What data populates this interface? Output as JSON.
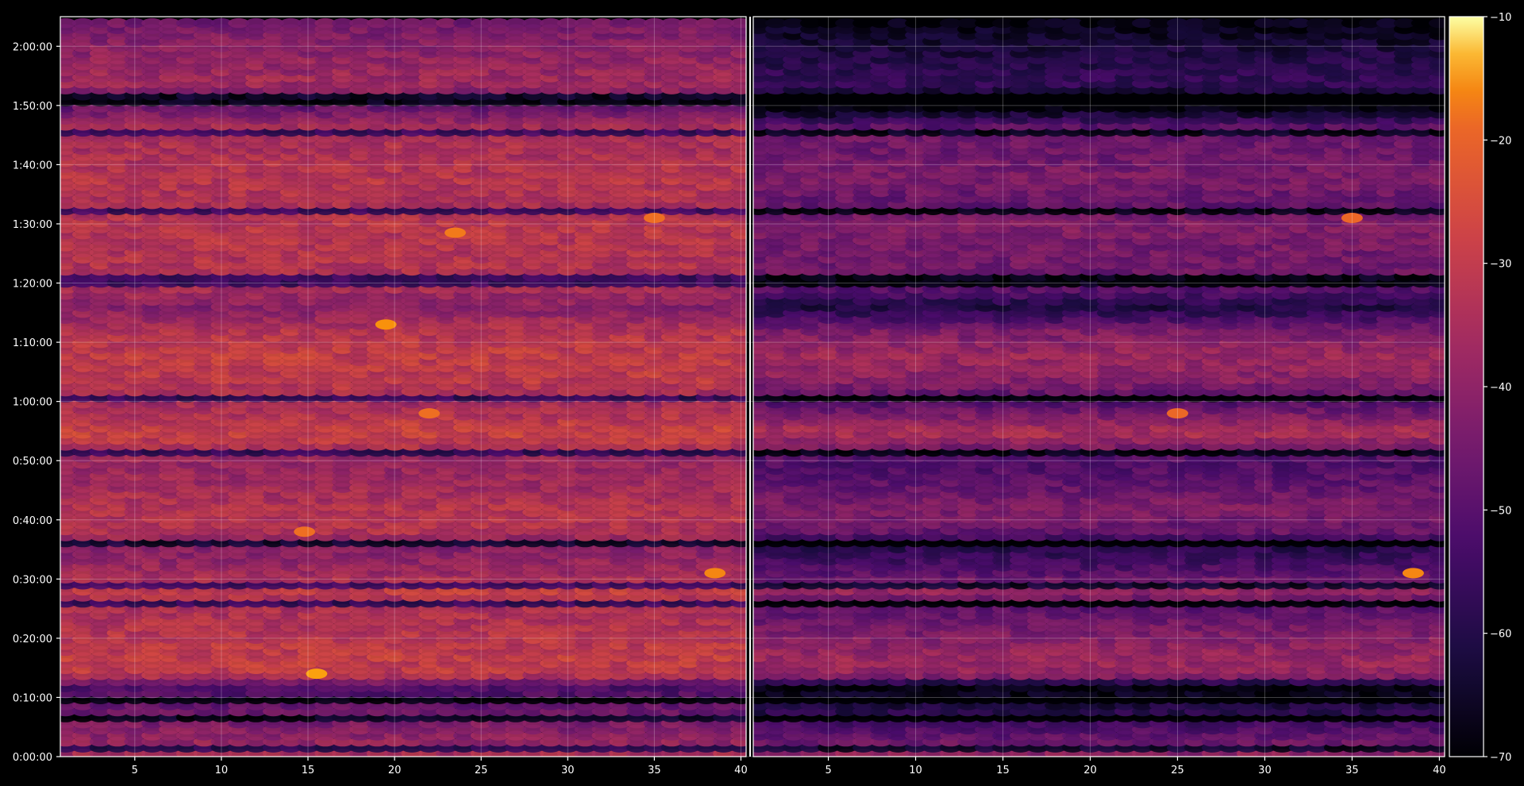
{
  "chart_data": {
    "type": "heatmap",
    "title": "",
    "xlabel": "",
    "ylabel": "",
    "grid": true,
    "colormap": "inferno",
    "colorbar": {
      "vmin": -70,
      "vmax": -10,
      "ticks": [
        "-10",
        "-20",
        "-30",
        "-40",
        "-50",
        "-60",
        "-70"
      ],
      "placement": "right"
    },
    "panels": [
      {
        "name": "left",
        "x_range": [
          1,
          40
        ],
        "x_ticks": [
          "5",
          "10",
          "15",
          "20",
          "25",
          "30",
          "35",
          "40"
        ]
      },
      {
        "name": "right",
        "x_range": [
          1,
          40
        ],
        "x_ticks": [
          "5",
          "10",
          "15",
          "20",
          "25",
          "30",
          "35",
          "40"
        ]
      }
    ],
    "y_range_seconds": [
      0,
      7500
    ],
    "y_ticks": [
      "0:00:00",
      "0:10:00",
      "0:20:00",
      "0:30:00",
      "0:40:00",
      "0:50:00",
      "1:00:00",
      "1:10:00",
      "1:20:00",
      "1:30:00",
      "1:40:00",
      "1:50:00",
      "2:00:00"
    ],
    "row_profile_y_minutes": [
      0,
      5,
      12,
      14,
      17,
      22,
      26,
      28,
      31,
      36,
      38,
      42,
      46,
      50,
      55,
      57,
      60,
      64,
      68,
      72,
      76,
      80,
      86,
      90,
      93,
      98,
      102,
      106,
      110,
      114,
      120,
      124
    ],
    "row_profile_left_db": [
      -34,
      -42,
      -52,
      -30,
      -29,
      -32,
      -34,
      -29,
      -36,
      -42,
      -33,
      -32,
      -36,
      -38,
      -27,
      -31,
      -36,
      -30,
      -29,
      -32,
      -41,
      -33,
      -32,
      -31,
      -34,
      -31,
      -34,
      -33,
      -48,
      -36,
      -40,
      -44
    ],
    "right_panel_offset_db": [
      -4,
      -10,
      -18,
      -8,
      -8,
      -12,
      -16,
      -9,
      -13,
      -18,
      -14,
      -10,
      -12,
      -14,
      -6,
      -9,
      -15,
      -10,
      -8,
      -11,
      -20,
      -13,
      -12,
      -11,
      -14,
      -12,
      -12,
      -12,
      -24,
      -20,
      -22,
      -24
    ],
    "highlight_points": [
      {
        "panel": "left",
        "x": 15.5,
        "y_minutes": 14,
        "value": -14
      },
      {
        "panel": "left",
        "x": 19.5,
        "y_minutes": 73,
        "value": -15
      },
      {
        "panel": "left",
        "x": 14.8,
        "y_minutes": 38,
        "value": -18
      },
      {
        "panel": "left",
        "x": 23.5,
        "y_minutes": 88.5,
        "value": -17
      },
      {
        "panel": "left",
        "x": 35,
        "y_minutes": 91,
        "value": -18
      },
      {
        "panel": "left",
        "x": 38.5,
        "y_minutes": 31,
        "value": -16
      },
      {
        "panel": "left",
        "x": 22,
        "y_minutes": 58,
        "value": -18
      },
      {
        "panel": "right",
        "x": 38.5,
        "y_minutes": 31,
        "value": -16
      },
      {
        "panel": "right",
        "x": 35,
        "y_minutes": 91,
        "value": -19
      },
      {
        "panel": "right",
        "x": 25,
        "y_minutes": 58,
        "value": -19
      }
    ]
  }
}
